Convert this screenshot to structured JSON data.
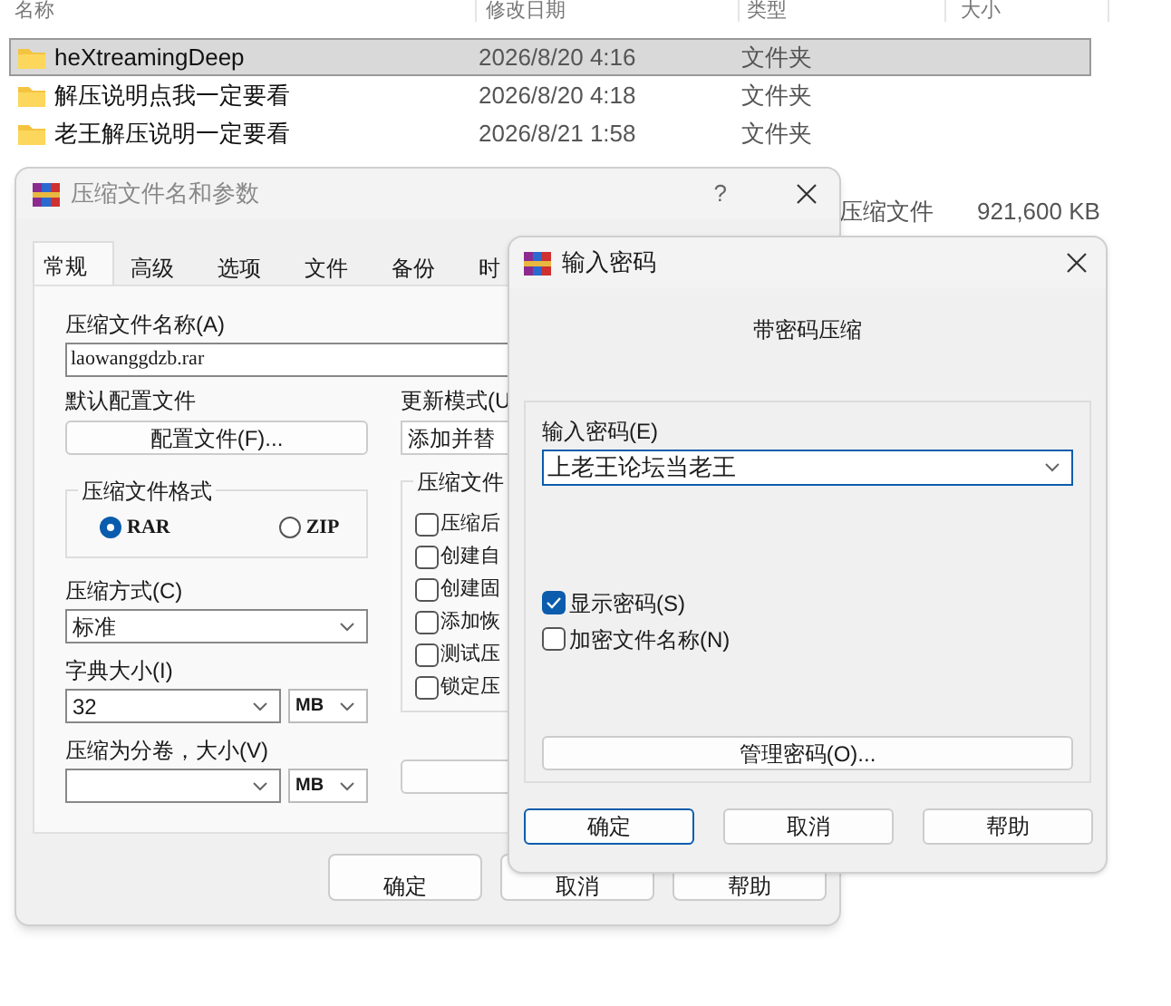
{
  "explorer": {
    "columns": [
      "名称",
      "修改日期",
      "类型",
      "大小"
    ],
    "rows": [
      {
        "name": "heXtreamingDeep",
        "modified": "2026/8/20 4:16",
        "type": "文件夹",
        "selected": true
      },
      {
        "name": "解压说明点我一定要看",
        "modified": "2026/8/20 4:18",
        "type": "文件夹",
        "selected": false
      },
      {
        "name": "老王解压说明一定要看",
        "modified": "2026/8/21 1:58",
        "type": "文件夹",
        "selected": false
      }
    ],
    "partial_row": {
      "type": "压缩文件",
      "size": "921,600 KB"
    }
  },
  "archive_dialog": {
    "title": "压缩文件名和参数",
    "help": "?",
    "tabs": [
      {
        "label": "常规",
        "selected": true
      },
      {
        "label": "高级",
        "selected": false
      },
      {
        "label": "选项",
        "selected": false
      },
      {
        "label": "文件",
        "selected": false
      },
      {
        "label": "备份",
        "selected": false
      },
      {
        "label": "时",
        "selected": false
      }
    ],
    "archive_name": {
      "label": "压缩文件名称(A)",
      "value": "laowanggdzb.rar"
    },
    "profile": {
      "label": "默认配置文件",
      "button": "配置文件(F)..."
    },
    "update_mode": {
      "label": "更新模式(U",
      "value": "添加并替"
    },
    "format": {
      "label": "压缩文件格式",
      "options": [
        {
          "label": "RAR",
          "selected": true
        },
        {
          "label": "ZIP",
          "selected": false
        }
      ]
    },
    "archive_options": {
      "label": "压缩文件",
      "items": [
        {
          "label": "压缩后",
          "checked": false
        },
        {
          "label": "创建自",
          "checked": false
        },
        {
          "label": "创建固",
          "checked": false
        },
        {
          "label": "添加恢",
          "checked": false
        },
        {
          "label": "测试压",
          "checked": false
        },
        {
          "label": "锁定压",
          "checked": false
        }
      ]
    },
    "method": {
      "label": "压缩方式(C)",
      "value": "标准"
    },
    "dictionary": {
      "label": "字典大小(I)",
      "value": "32",
      "unit": "MB"
    },
    "volumes": {
      "label": "压缩为分卷，大小(V)",
      "unit": "MB"
    },
    "buttons": [
      "确定",
      "取消",
      "帮助"
    ]
  },
  "password_dialog": {
    "title": "输入密码",
    "heading": "带密码压缩",
    "password": {
      "label": "输入密码(E)",
      "value": "上老王论坛当老王"
    },
    "options": [
      {
        "label": "显示密码(S)",
        "checked": true
      },
      {
        "label": "加密文件名称(N)",
        "checked": false
      }
    ],
    "manage_button": "管理密码(O)...",
    "buttons": [
      "确定",
      "取消",
      "帮助"
    ]
  }
}
